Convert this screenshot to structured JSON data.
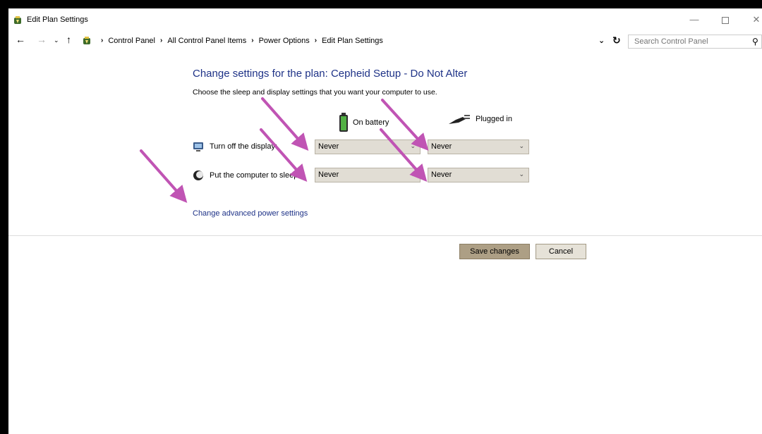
{
  "window": {
    "title": "Edit Plan Settings",
    "minimize_label": "—",
    "close_label": "✕"
  },
  "nav": {
    "back": "←",
    "forward": "→",
    "recent": "⌄",
    "up": "↑",
    "refresh": "↻",
    "dropdown": "⌄"
  },
  "breadcrumb": {
    "items": [
      "Control Panel",
      "All Control Panel Items",
      "Power Options",
      "Edit Plan Settings"
    ],
    "separator": "›"
  },
  "search": {
    "placeholder": "Search Control Panel"
  },
  "content": {
    "heading": "Change settings for the plan: Cepheid Setup - Do Not Alter",
    "subheading": "Choose the sleep and display settings that you want your computer to use.",
    "battery_label": "On battery",
    "plugged_label": "Plugged in",
    "display_label": "Turn off the display:",
    "sleep_label": "Put the computer to sleep:",
    "display_battery": "Never",
    "display_plugged": "Never",
    "sleep_battery": "Never",
    "sleep_plugged": "Never",
    "advanced_link": "Change advanced power settings",
    "save_button": "Save changes",
    "cancel_button": "Cancel"
  },
  "icons": [
    "power-options-icon",
    "battery-icon",
    "plug-icon",
    "monitor-icon",
    "moon-icon",
    "search-icon"
  ],
  "colors": {
    "heading": "#1e3287",
    "arrow_annotation": "#c054b4",
    "save_button": "#ad9f85"
  }
}
